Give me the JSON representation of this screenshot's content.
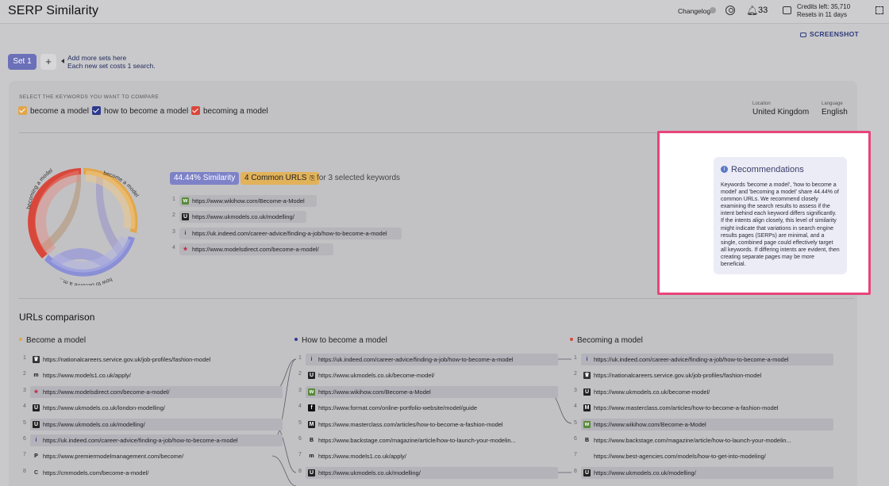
{
  "app": {
    "title": "SERP Similarity"
  },
  "header": {
    "changelog": "Changelog",
    "notifications": "33",
    "credits_line1": "Credits left: 35,710",
    "credits_line2": "Resets in 11 days"
  },
  "toolbar": {
    "screenshot": "SCREENSHOT"
  },
  "sets": {
    "active": "Set 1",
    "add": "+",
    "hint_line1": "Add more sets here",
    "hint_line2": "Each new set costs 1 search."
  },
  "keywords": {
    "label": "SELECT THE KEYWORDS YOU WANT TO COMPARE",
    "items": [
      {
        "label": "become a model",
        "color": "#e2a64a"
      },
      {
        "label": "how to become a model",
        "color": "#2d3a8c"
      },
      {
        "label": "becoming a model",
        "color": "#d9473b"
      }
    ],
    "location_label": "Location",
    "location": "United Kingdom",
    "language_label": "Language",
    "language": "English"
  },
  "chord": {
    "labels": [
      "become a model",
      "how to become a m...",
      "becoming a model"
    ],
    "colors": [
      "#e2a64a",
      "#8a8fd6",
      "#d9473b"
    ]
  },
  "summary": {
    "similarity": "44.44% Similarity",
    "common": "4 Common URLS",
    "for_text": "for 3 selected keywords",
    "urls": [
      {
        "num": "1",
        "url": "https://www.wikihow.com/Become-a-Model",
        "icon": "wikihow-icon"
      },
      {
        "num": "2",
        "url": "https://www.ukmodels.co.uk/modelling/",
        "icon": "ukmodels-icon"
      },
      {
        "num": "3",
        "url": "https://uk.indeed.com/career-advice/finding-a-job/how-to-become-a-model",
        "icon": "indeed-icon"
      },
      {
        "num": "4",
        "url": "https://www.modelsdirect.com/become-a-model/",
        "icon": "star-icon"
      }
    ]
  },
  "recommendations": {
    "title": "Recommendations",
    "text": "Keywords 'become a model', 'how to become a model' and 'becoming a model' share 44.44% of common URLs. We recommend closely examining the search results to assess if the intent behind each keyword differs significantly. If the intents align closely, this level of similarity might indicate that variations in search engine results pages (SERPs) are minimal, and a single, combined page could effectively target all keywords. If differing intents are evident, then creating separate pages may be more beneficial."
  },
  "comparison": {
    "title": "URLs comparison",
    "columns": [
      {
        "title": "Become a model",
        "color": "#e2a64a",
        "rows": [
          {
            "num": "1",
            "url": "https://nationalcareers.service.gov.uk/job-profiles/fashion-model",
            "hl": false,
            "icon": "gov-icon"
          },
          {
            "num": "2",
            "url": "https://www.models1.co.uk/apply/",
            "hl": false,
            "icon": "models1-icon"
          },
          {
            "num": "3",
            "url": "https://www.modelsdirect.com/become-a-model/",
            "hl": true,
            "icon": "star-icon"
          },
          {
            "num": "4",
            "url": "https://www.ukmodels.co.uk/london-modelling/",
            "hl": false,
            "icon": "ukmodels-icon"
          },
          {
            "num": "5",
            "url": "https://www.ukmodels.co.uk/modelling/",
            "hl": true,
            "icon": "ukmodels-icon"
          },
          {
            "num": "6",
            "url": "https://uk.indeed.com/career-advice/finding-a-job/how-to-become-a-model",
            "hl": true,
            "icon": "indeed-icon"
          },
          {
            "num": "7",
            "url": "https://www.premiermodelmanagement.com/become/",
            "hl": false,
            "icon": "premier-icon"
          },
          {
            "num": "8",
            "url": "https://cmmodels.com/become-a-model/",
            "hl": false,
            "icon": "cm-icon"
          }
        ]
      },
      {
        "title": "How to become a model",
        "color": "#2d3a8c",
        "rows": [
          {
            "num": "1",
            "url": "https://uk.indeed.com/career-advice/finding-a-job/how-to-become-a-model",
            "hl": true,
            "icon": "indeed-icon"
          },
          {
            "num": "2",
            "url": "https://www.ukmodels.co.uk/become-model/",
            "hl": false,
            "icon": "ukmodels-icon"
          },
          {
            "num": "3",
            "url": "https://www.wikihow.com/Become-a-Model",
            "hl": true,
            "icon": "wikihow-icon"
          },
          {
            "num": "4",
            "url": "https://www.format.com/online-portfolio-website/model/guide",
            "hl": false,
            "icon": "format-icon"
          },
          {
            "num": "5",
            "url": "https://www.masterclass.com/articles/how-to-become-a-fashion-model",
            "hl": false,
            "icon": "masterclass-icon"
          },
          {
            "num": "6",
            "url": "https://www.backstage.com/magazine/article/how-to-launch-your-modelin...",
            "hl": false,
            "icon": "backstage-icon"
          },
          {
            "num": "7",
            "url": "https://www.models1.co.uk/apply/",
            "hl": false,
            "icon": "models1-icon"
          },
          {
            "num": "8",
            "url": "https://www.ukmodels.co.uk/modelling/",
            "hl": true,
            "icon": "ukmodels-icon"
          }
        ]
      },
      {
        "title": "Becoming a model",
        "color": "#d9473b",
        "rows": [
          {
            "num": "1",
            "url": "https://uk.indeed.com/career-advice/finding-a-job/how-to-become-a-model",
            "hl": true,
            "icon": "indeed-icon"
          },
          {
            "num": "2",
            "url": "https://nationalcareers.service.gov.uk/job-profiles/fashion-model",
            "hl": false,
            "icon": "gov-icon"
          },
          {
            "num": "3",
            "url": "https://www.ukmodels.co.uk/become-model/",
            "hl": false,
            "icon": "ukmodels-icon"
          },
          {
            "num": "4",
            "url": "https://www.masterclass.com/articles/how-to-become-a-fashion-model",
            "hl": false,
            "icon": "masterclass-icon"
          },
          {
            "num": "5",
            "url": "https://www.wikihow.com/Become-a-Model",
            "hl": true,
            "icon": "wikihow-icon"
          },
          {
            "num": "6",
            "url": "https://www.backstage.com/magazine/article/how-to-launch-your-modelin...",
            "hl": false,
            "icon": "backstage-icon"
          },
          {
            "num": "7",
            "url": "https://www.best-agencies.com/models/how-to-get-into-modeling/",
            "hl": false,
            "icon": "blank-icon"
          },
          {
            "num": "8",
            "url": "https://www.ukmodels.co.uk/modelling/",
            "hl": true,
            "icon": "ukmodels-icon"
          }
        ]
      }
    ]
  }
}
